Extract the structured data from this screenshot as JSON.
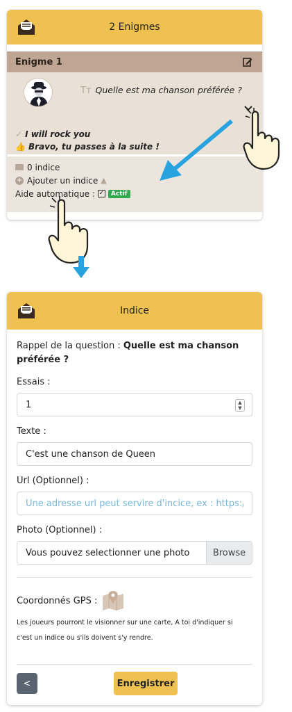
{
  "top_card": {
    "header_title": "2 Enigmes",
    "header_icon": "envelope-list-icon",
    "enigme": {
      "title": "Enigme 1",
      "edit_icon": "edit-icon",
      "tt_glyph": "Tт",
      "question": "Quelle est ma chanson préférée ?",
      "answer": "I will rock you",
      "success_message": "Bravo, tu passes à la suite !"
    },
    "hints": {
      "count_label": "0 indice",
      "add_label": "Ajouter un indice",
      "auto_help_label": "Aide automatique :",
      "active_badge": "Actif"
    }
  },
  "form_card": {
    "header_title": "Indice",
    "header_icon": "envelope-list-icon",
    "recall_prefix": "Rappel de la question :",
    "recall_question": "Quelle est ma chanson préférée ?",
    "tries_label": "Essais :",
    "tries_value": "1",
    "text_label": "Texte :",
    "text_value": "C'est une chanson de Queen",
    "url_label": "Url (Optionnel) :",
    "url_placeholder": "Une adresse url peut servire d'incice, ex : https://ww",
    "photo_label": "Photo (Optionnel) :",
    "photo_placeholder": "Vous pouvez selectionner une photo",
    "browse_label": "Browse",
    "gps_label": "Coordonnés GPS :",
    "gps_help_line1": "Les joueurs pourront le visionner sur une carte, A toi d'indiquer si",
    "gps_help_line2": "c'est un indice ou s'ils doivent s'y rendre.",
    "back_label": "<",
    "save_label": "Enregistrer"
  },
  "colors": {
    "header_yellow": "#efc150",
    "enigme_brown": "#bfa593",
    "enigme_body": "#e9e0d6",
    "arrow_blue": "#29a3e0",
    "badge_green": "#2fa84f"
  }
}
